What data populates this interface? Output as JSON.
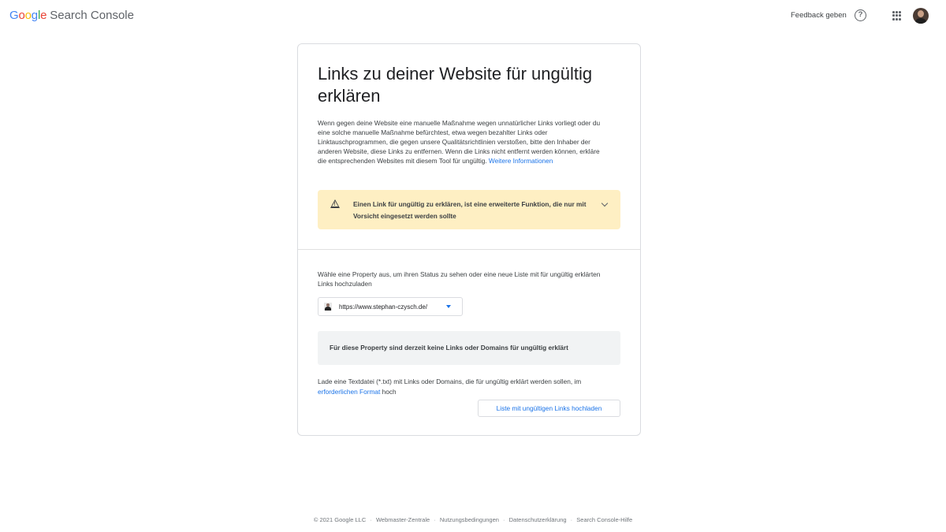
{
  "header": {
    "logo_google": "Google",
    "logo_product": "Search Console",
    "feedback_label": "Feedback geben",
    "help_icon": "help-circle-icon",
    "apps_icon": "apps-grid-icon"
  },
  "colors": {
    "google_blue": "#4285F4",
    "google_red": "#EA4335",
    "google_yellow": "#FBBC05",
    "google_green": "#34A853",
    "warning_bg": "#feefc3",
    "link": "#1a73e8"
  },
  "card": {
    "title": "Links zu deiner Website für ungültig erklären",
    "intro_text": "Wenn gegen deine Website eine manuelle Maßnahme wegen unnatürlicher Links vorliegt oder du eine solche manuelle Maßnahme befürchtest, etwa wegen bezahlter Links oder Linktauschprogrammen, die gegen unsere Qualitätsrichtlinien verstoßen, bitte den Inhaber der anderen Website, diese Links zu entfernen. Wenn die Links nicht entfernt werden können, erkläre die entsprechenden Websites mit diesem Tool für ungültig. ",
    "intro_link": "Weitere Informationen",
    "warning": {
      "icon": "warning-triangle-icon",
      "text": "Einen Link für ungültig zu erklären, ist eine erweiterte Funktion, die nur mit Vorsicht eingesetzt werden sollte",
      "expand_icon": "chevron-down-icon"
    },
    "property_prompt": "Wähle eine Property aus, um ihren Status zu sehen oder eine neue Liste mit für ungültig erklärten Links hochzuladen",
    "property_select": {
      "value": "https://www.stephan-czysch.de/"
    },
    "empty_state": "Für diese Property sind derzeit keine Links oder Domains für ungültig erklärt",
    "upload_text_before": "Lade eine Textdatei (*.txt) mit Links oder Domains, die für ungültig erklärt werden sollen, im ",
    "upload_link": "erforderlichen Format",
    "upload_text_after": " hoch",
    "upload_button": "Liste mit ungültigen Links hochladen"
  },
  "footer": {
    "copyright": "© 2021 Google LLC",
    "links": [
      "Webmaster-Zentrale",
      "Nutzungsbedingungen",
      "Datenschutzerklärung",
      "Search Console-Hilfe"
    ],
    "separator": "·"
  }
}
